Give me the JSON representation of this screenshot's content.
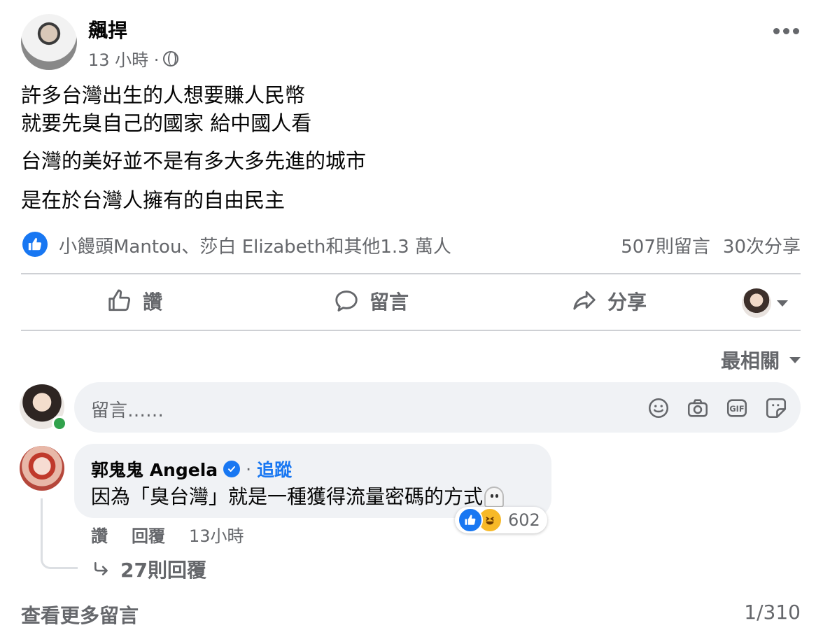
{
  "post": {
    "author": "飆捍",
    "time": "13 小時 ·",
    "lines": [
      "許多台灣出生的人想要賺人民幣",
      "就要先臭自己的國家 給中國人看",
      "台灣的美好並不是有多大多先進的城市",
      "是在於台灣人擁有的自由民主"
    ],
    "reactors_text": "小饅頭Mantou、莎白 Elizabeth和其他1.3 萬人",
    "comments_count": "507則留言",
    "shares_count": "30次分享"
  },
  "actions": {
    "like": "讚",
    "comment": "留言",
    "share": "分享"
  },
  "sort_label": "最相關",
  "comment_input": {
    "placeholder": "留言……"
  },
  "comment": {
    "name": "郭鬼鬼 Angela",
    "separator": "·",
    "follow": "追蹤",
    "text": "因為「臭台灣」就是一種獲得流量密碼的方式",
    "reaction_count": "602",
    "like_label": "讚",
    "reply_label": "回覆",
    "time": "13小時",
    "replies": "27則回覆"
  },
  "footer": {
    "view_more": "查看更多留言",
    "pager": "1/310"
  },
  "colors": {
    "accent": "#1877f2",
    "muted_text": "#65676b",
    "bubble_bg": "#f0f2f5",
    "online": "#31a24c"
  }
}
